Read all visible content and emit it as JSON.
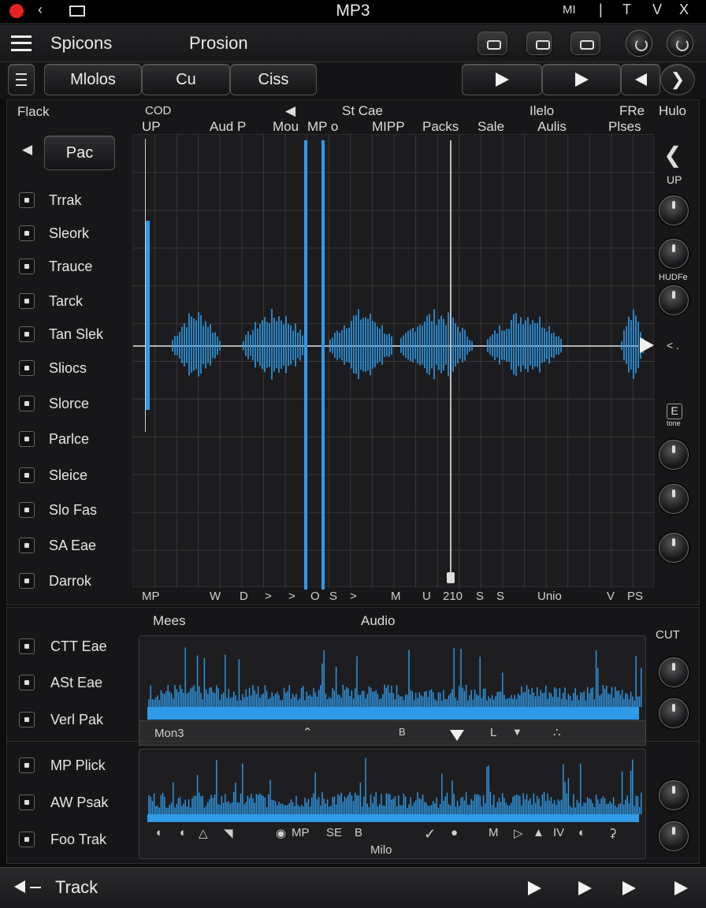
{
  "window": {
    "title": "MP3",
    "right_labels": [
      "MI",
      "T",
      "V",
      "X"
    ]
  },
  "menubar": {
    "left_menu": "Spicons",
    "right_menu": "Prosion"
  },
  "toolbar": {
    "buttons": [
      "Mlolos",
      "Cu",
      "Ciss"
    ]
  },
  "main": {
    "headers": {
      "left": "Flack",
      "up": "UP",
      "cod": "COD",
      "audip": "Aud P",
      "mou": "Mou",
      "mpo": "MP o",
      "stcae": "St Cae",
      "mipp": "MIPP",
      "packs": "Packs",
      "sale": "Sale",
      "ilelo": "Ilelo",
      "aulis": "Aulis",
      "fre": "FRe",
      "pises": "Plses",
      "hulo": "Hulo",
      "right_up": "UP",
      "hub": "HUDFe",
      "e_label": "E",
      "e_sub": "tone"
    },
    "track_button": "Pac",
    "tracks": [
      "Trrak",
      "Sleork",
      "Trauce",
      "Tarck",
      "Tan Slek",
      "Sliocs",
      "Slorce",
      "Parlce",
      "Sleice",
      "Slo Fas",
      "SA Eae",
      "Darrok"
    ],
    "ruler": [
      "MP",
      "W",
      "D",
      ">",
      ">",
      "O",
      "S",
      ">",
      "M",
      "U",
      "210",
      "S",
      "S",
      "Unio",
      "V",
      "PS"
    ]
  },
  "lower": {
    "mees": "Mees",
    "audio": "Audio",
    "cut": "CUT",
    "tracks_a": [
      "CTT Eae",
      "ASt Eae",
      "Verl Pak"
    ],
    "strip_a": [
      "Mon3",
      "B",
      "L"
    ],
    "tracks_b": [
      "MP Plick",
      "AW Psak",
      "Foo Trak"
    ],
    "strip_b": [
      "MP",
      "SE",
      "B",
      "M",
      "IV",
      "Milo"
    ]
  },
  "bottom": {
    "label": "Track"
  },
  "colors": {
    "accent": "#2f9be8",
    "background": "#0d0d0e"
  }
}
